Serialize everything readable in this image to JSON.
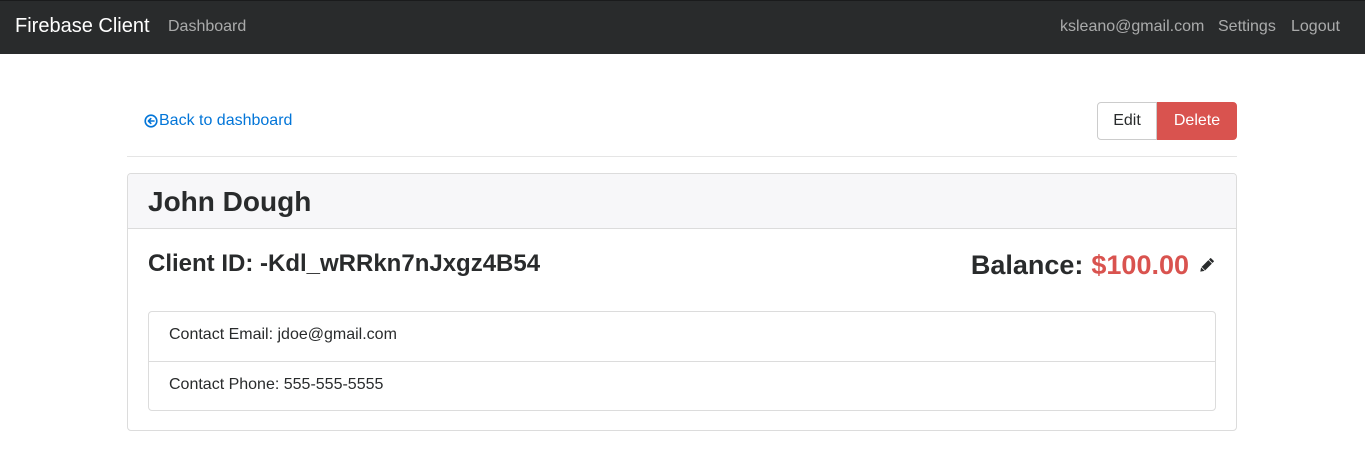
{
  "navbar": {
    "brand": "Firebase Client",
    "links": [
      "Dashboard"
    ],
    "user_email": "ksleano@gmail.com",
    "settings": "Settings",
    "logout": "Logout"
  },
  "actions": {
    "back_label": "Back to dashboard",
    "edit_label": "Edit",
    "delete_label": "Delete"
  },
  "client": {
    "name": "John Dough",
    "id_label": "Client ID:",
    "id_value": "-Kdl_wRRkn7nJxgz4B54",
    "balance_label": "Balance:",
    "balance_value": "$100.00",
    "email_label": "Contact Email:",
    "email_value": "jdoe@gmail.com",
    "phone_label": "Contact Phone:",
    "phone_value": "555-555-5555"
  },
  "colors": {
    "navbar_bg": "#292b2c",
    "link": "#0275d8",
    "danger": "#d9534f"
  },
  "icons": {
    "back": "arrow-circle-left-icon",
    "edit_balance": "pencil-icon"
  }
}
